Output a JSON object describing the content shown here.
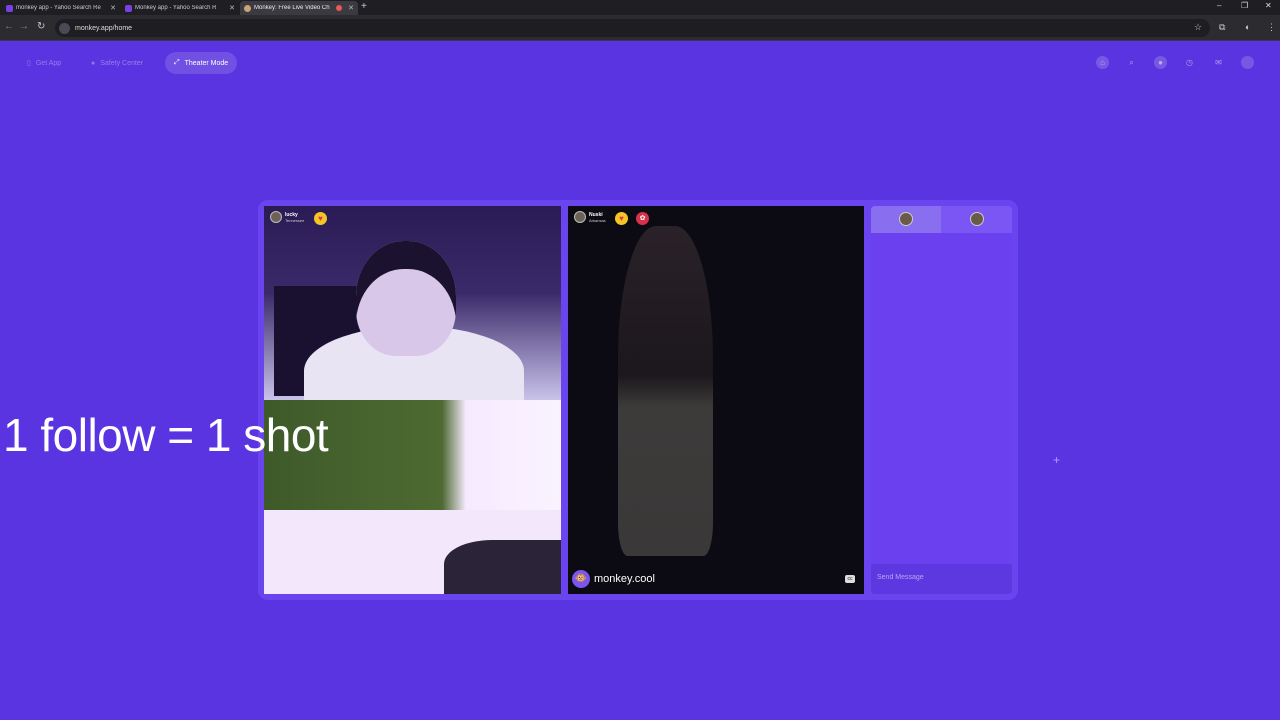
{
  "browser": {
    "tabs": [
      {
        "title": "monkey app - Yahoo Search Re"
      },
      {
        "title": "Monkey app - Yahoo Search R"
      },
      {
        "title": "Monkey: Free Live Video Ch"
      }
    ],
    "url": "monkey.app/home"
  },
  "header": {
    "get_app": "Get App",
    "safety_center": "Safety Center",
    "theater_mode": "Theater Mode"
  },
  "users": {
    "left": {
      "name": "lucky",
      "location": "Tennessee"
    },
    "right": {
      "name": "Nuski",
      "location": "Arkansas"
    }
  },
  "brand": {
    "name": "monkey.cool"
  },
  "overlay_text": "1 follow = 1 shot",
  "chat": {
    "placeholder": "Send Message"
  },
  "colors": {
    "background": "#5a34e0",
    "panel": "#6b40ee"
  }
}
